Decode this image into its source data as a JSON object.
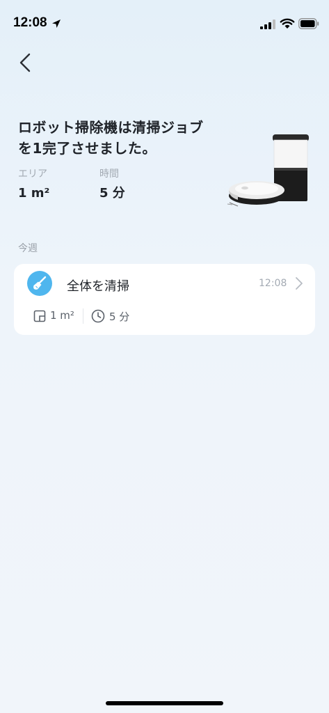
{
  "status_bar": {
    "time": "12:08",
    "icons": [
      "location-arrow-icon",
      "cellular-signal-icon",
      "wifi-icon",
      "battery-icon"
    ]
  },
  "nav": {
    "back_icon": "chevron-left-icon"
  },
  "summary": {
    "headline_line1": "ロボット掃除機は清掃ジョブ",
    "headline_line2": "を1完了させました。",
    "area_label": "エリア",
    "area_value": "1 m²",
    "time_label": "時間",
    "time_value": "5 分"
  },
  "history": {
    "section_label": "今週",
    "jobs": [
      {
        "icon": "broom-icon",
        "title": "全体を清掃",
        "time": "12:08",
        "area": "1 m²",
        "duration": "5 分"
      }
    ]
  },
  "colors": {
    "accent": "#4fb6ee",
    "text_primary": "#1f2329",
    "text_secondary": "#a3aab3",
    "card_bg": "#ffffff"
  }
}
